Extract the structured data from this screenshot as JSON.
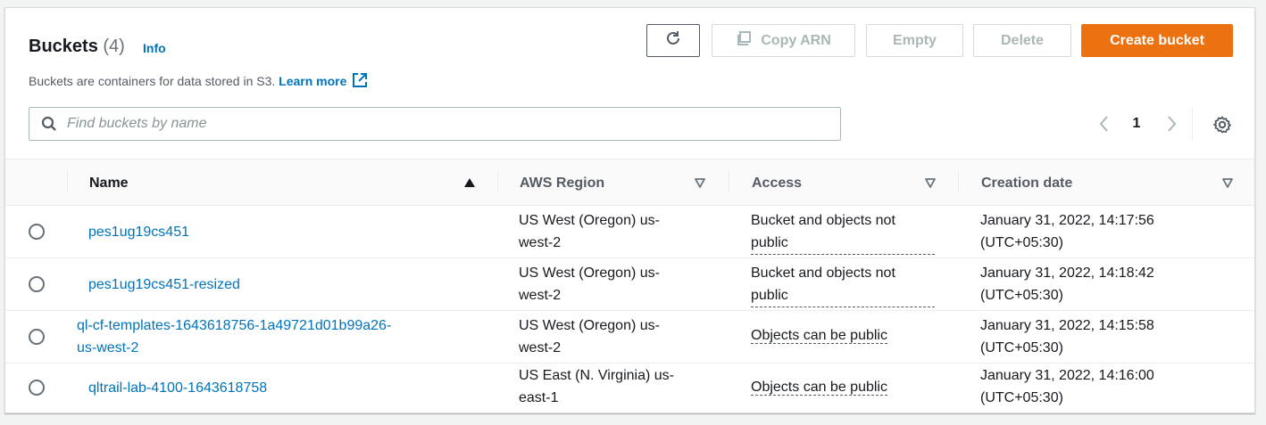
{
  "header": {
    "title": "Buckets",
    "count": "(4)",
    "info_link": "Info",
    "description": "Buckets are containers for data stored in S3.",
    "learn_more": "Learn more"
  },
  "actions": {
    "refresh_icon": "refresh-icon",
    "copy_arn": "Copy ARN",
    "empty": "Empty",
    "delete": "Delete",
    "create_bucket": "Create bucket"
  },
  "search": {
    "placeholder": "Find buckets by name",
    "value": ""
  },
  "pagination": {
    "current_page": "1"
  },
  "table": {
    "columns": [
      {
        "label": "Name",
        "sort": "ascending"
      },
      {
        "label": "AWS Region",
        "sort": "none"
      },
      {
        "label": "Access",
        "sort": "none"
      },
      {
        "label": "Creation date",
        "sort": "none"
      }
    ],
    "rows": [
      {
        "name": "pes1ug19cs451",
        "region_l1": "US West (Oregon) us-",
        "region_l2": "west-2",
        "access_l1": "Bucket and objects not",
        "access_l2": "public",
        "date_l1": "January 31, 2022, 14:17:56",
        "date_l2": "(UTC+05:30)"
      },
      {
        "name": "pes1ug19cs451-resized",
        "region_l1": "US West (Oregon) us-",
        "region_l2": "west-2",
        "access_l1": "Bucket and objects not",
        "access_l2": "public",
        "date_l1": "January 31, 2022, 14:18:42",
        "date_l2": "(UTC+05:30)"
      },
      {
        "name_l1": "ql-cf-templates-1643618756-1a49721d01b99a26-",
        "name_l2": "us-west-2",
        "region_l1": "US West (Oregon) us-",
        "region_l2": "west-2",
        "access": "Objects can be public",
        "date_l1": "January 31, 2022, 14:15:58",
        "date_l2": "(UTC+05:30)"
      },
      {
        "name": "qltrail-lab-4100-1643618758",
        "region_l1": "US East (N. Virginia) us-",
        "region_l2": "east-1",
        "access": "Objects can be public",
        "date_l1": "January 31, 2022, 14:16:00",
        "date_l2": "(UTC+05:30)"
      }
    ]
  },
  "colors": {
    "primary": "#ec7211",
    "link": "#0073bb",
    "text": "#16191f",
    "muted": "#545b64",
    "disabled": "#aab7b8"
  }
}
